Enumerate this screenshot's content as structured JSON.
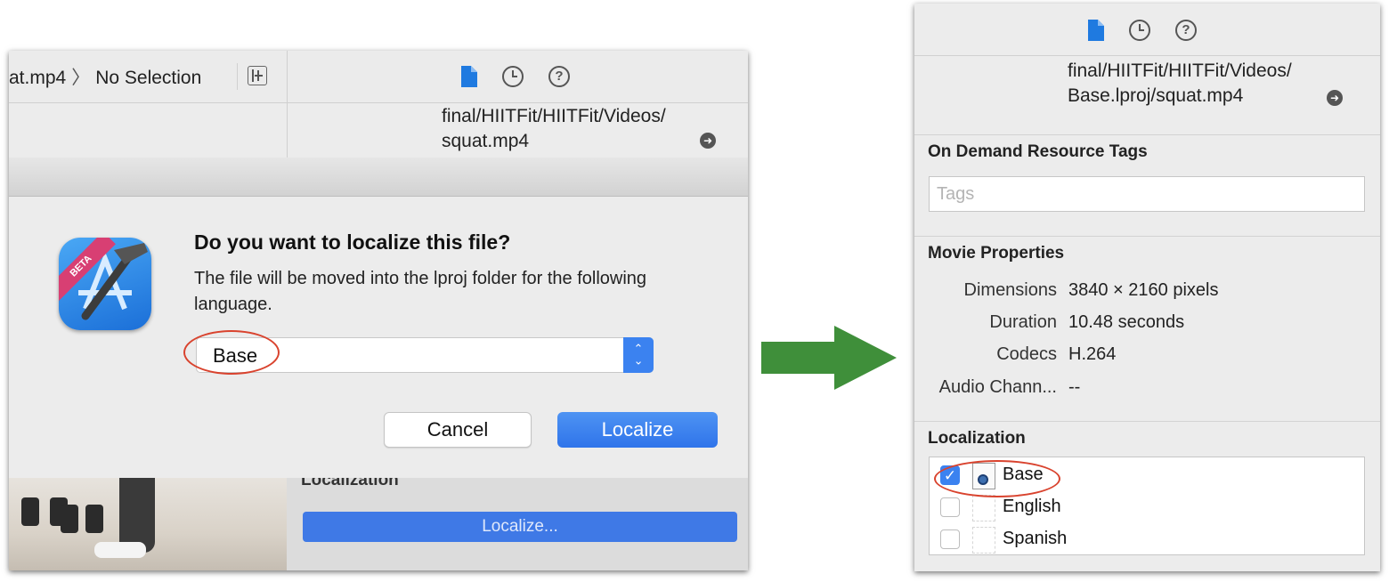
{
  "left_panel": {
    "breadcrumb": {
      "file": "at.mp4",
      "selection": "No Selection"
    },
    "path_lines": [
      "final/HIITFit/HIITFit/Videos/",
      "squat.mp4"
    ],
    "dialog": {
      "title": "Do you want to localize this file?",
      "message": "The file will be moved into the lproj folder for the following language.",
      "badge": "BETA",
      "language_select_value": "Base",
      "cancel_label": "Cancel",
      "localize_label": "Localize"
    },
    "background_section_label": "Localization",
    "background_localize_button": "Localize..."
  },
  "right_panel": {
    "path_lines": [
      "final/HIITFit/HIITFit/Videos/",
      "Base.lproj/squat.mp4"
    ],
    "on_demand": {
      "title": "On Demand Resource Tags",
      "tags_placeholder": "Tags"
    },
    "movie_properties": {
      "title": "Movie Properties",
      "rows": [
        {
          "key": "Dimensions",
          "value": "3840 × 2160 pixels"
        },
        {
          "key": "Duration",
          "value": "10.48 seconds"
        },
        {
          "key": "Codecs",
          "value": "H.264"
        },
        {
          "key": "Audio Chann...",
          "value": "--"
        }
      ]
    },
    "localization": {
      "title": "Localization",
      "items": [
        {
          "label": "Base",
          "checked": true
        },
        {
          "label": "English",
          "checked": false
        },
        {
          "label": "Spanish",
          "checked": false
        }
      ]
    }
  },
  "colors": {
    "accent_blue": "#3b82f0",
    "highlight_ring": "#d9432e",
    "arrow_green": "#3f8f3a"
  },
  "icons": [
    "file-inspector-icon",
    "history-icon",
    "help-icon",
    "go-to-icon",
    "add-editor-icon",
    "checkmark-icon"
  ]
}
